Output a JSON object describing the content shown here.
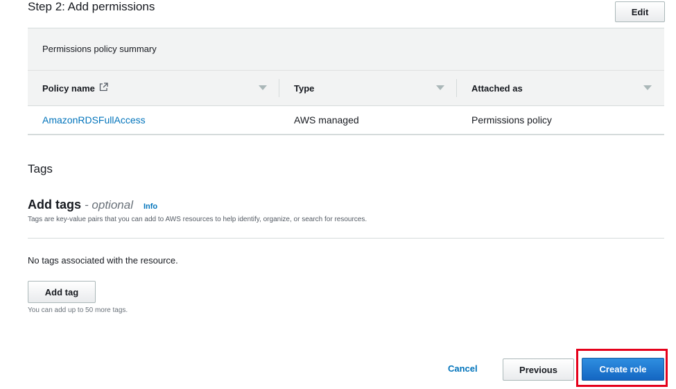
{
  "step_title": "Step 2: Add permissions",
  "edit_label": "Edit",
  "summary_title": "Permissions policy summary",
  "columns": [
    "Policy name",
    "Type",
    "Attached as"
  ],
  "rows": [
    {
      "policy_name": "AmazonRDSFullAccess",
      "type": "AWS managed",
      "attached_as": "Permissions policy"
    }
  ],
  "tags": {
    "heading": "Tags",
    "add_tags_title": "Add tags",
    "optional": "- optional",
    "info": "Info",
    "description": "Tags are key-value pairs that you can add to AWS resources to help identify, organize, or search for resources.",
    "empty": "No tags associated with the resource.",
    "add_tag_label": "Add tag",
    "limit": "You can add up to 50 more tags."
  },
  "footer": {
    "cancel": "Cancel",
    "previous": "Previous",
    "create": "Create role"
  },
  "colors": {
    "link": "#0073bb",
    "primary": "#1466c2",
    "highlight": "#e5001a"
  }
}
